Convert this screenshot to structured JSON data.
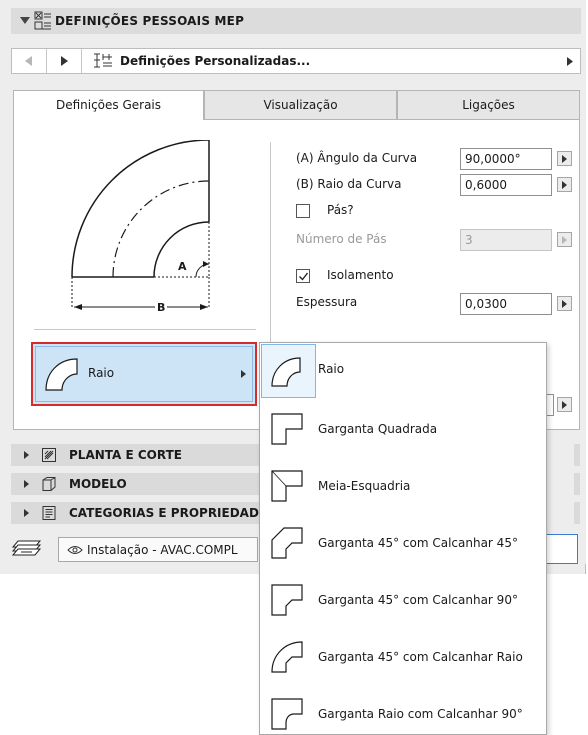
{
  "header": {
    "title": "DEFINIÇÕES PESSOAIS MEP",
    "icon": "mep-settings-icon"
  },
  "nav": {
    "label": "Definições Personalizadas...",
    "icon": "custom-settings-icon"
  },
  "tabs": [
    {
      "label": "Definições Gerais",
      "active": true
    },
    {
      "label": "Visualização",
      "active": false
    },
    {
      "label": "Ligações",
      "active": false
    }
  ],
  "diagram": {
    "label_a": "A",
    "label_b": "B"
  },
  "properties": {
    "angulo": {
      "label": "(A) Ângulo da Curva",
      "value": "90,0000°"
    },
    "raio": {
      "label": "(B) Raio da Curva",
      "value": "0,6000"
    },
    "pas": {
      "label": "Pás?",
      "checked": false
    },
    "numero_pas": {
      "label": "Número de Pás",
      "value": "3",
      "enabled": false
    },
    "isolamento": {
      "label": "Isolamento",
      "checked": true
    },
    "espessura": {
      "label": "Espessura",
      "value": "0,0300"
    }
  },
  "selector": {
    "label": "Raio"
  },
  "sections": [
    {
      "title": "PLANTA E CORTE",
      "icon": "floor-plan-icon"
    },
    {
      "title": "MODELO",
      "icon": "3d-model-icon"
    },
    {
      "title": "CATEGORIAS E PROPRIEDADES",
      "icon": "categories-icon"
    }
  ],
  "bottom": {
    "installation": "Instalação - AVAC.COMPL"
  },
  "dropdown": {
    "items": [
      {
        "label": "Raio",
        "selected": true
      },
      {
        "label": "Garganta Quadrada",
        "selected": false
      },
      {
        "label": "Meia-Esquadria",
        "selected": false
      },
      {
        "label": "Garganta 45° com Calcanhar 45°",
        "selected": false
      },
      {
        "label": "Garganta 45° com Calcanhar 90°",
        "selected": false
      },
      {
        "label": "Garganta 45° com Calcanhar Raio",
        "selected": false
      },
      {
        "label": "Garganta Raio com Calcanhar 90°",
        "selected": false
      }
    ]
  },
  "colors": {
    "selection": "#cde4f7",
    "highlight_border": "#d62b2b",
    "panel": "#ededed"
  }
}
